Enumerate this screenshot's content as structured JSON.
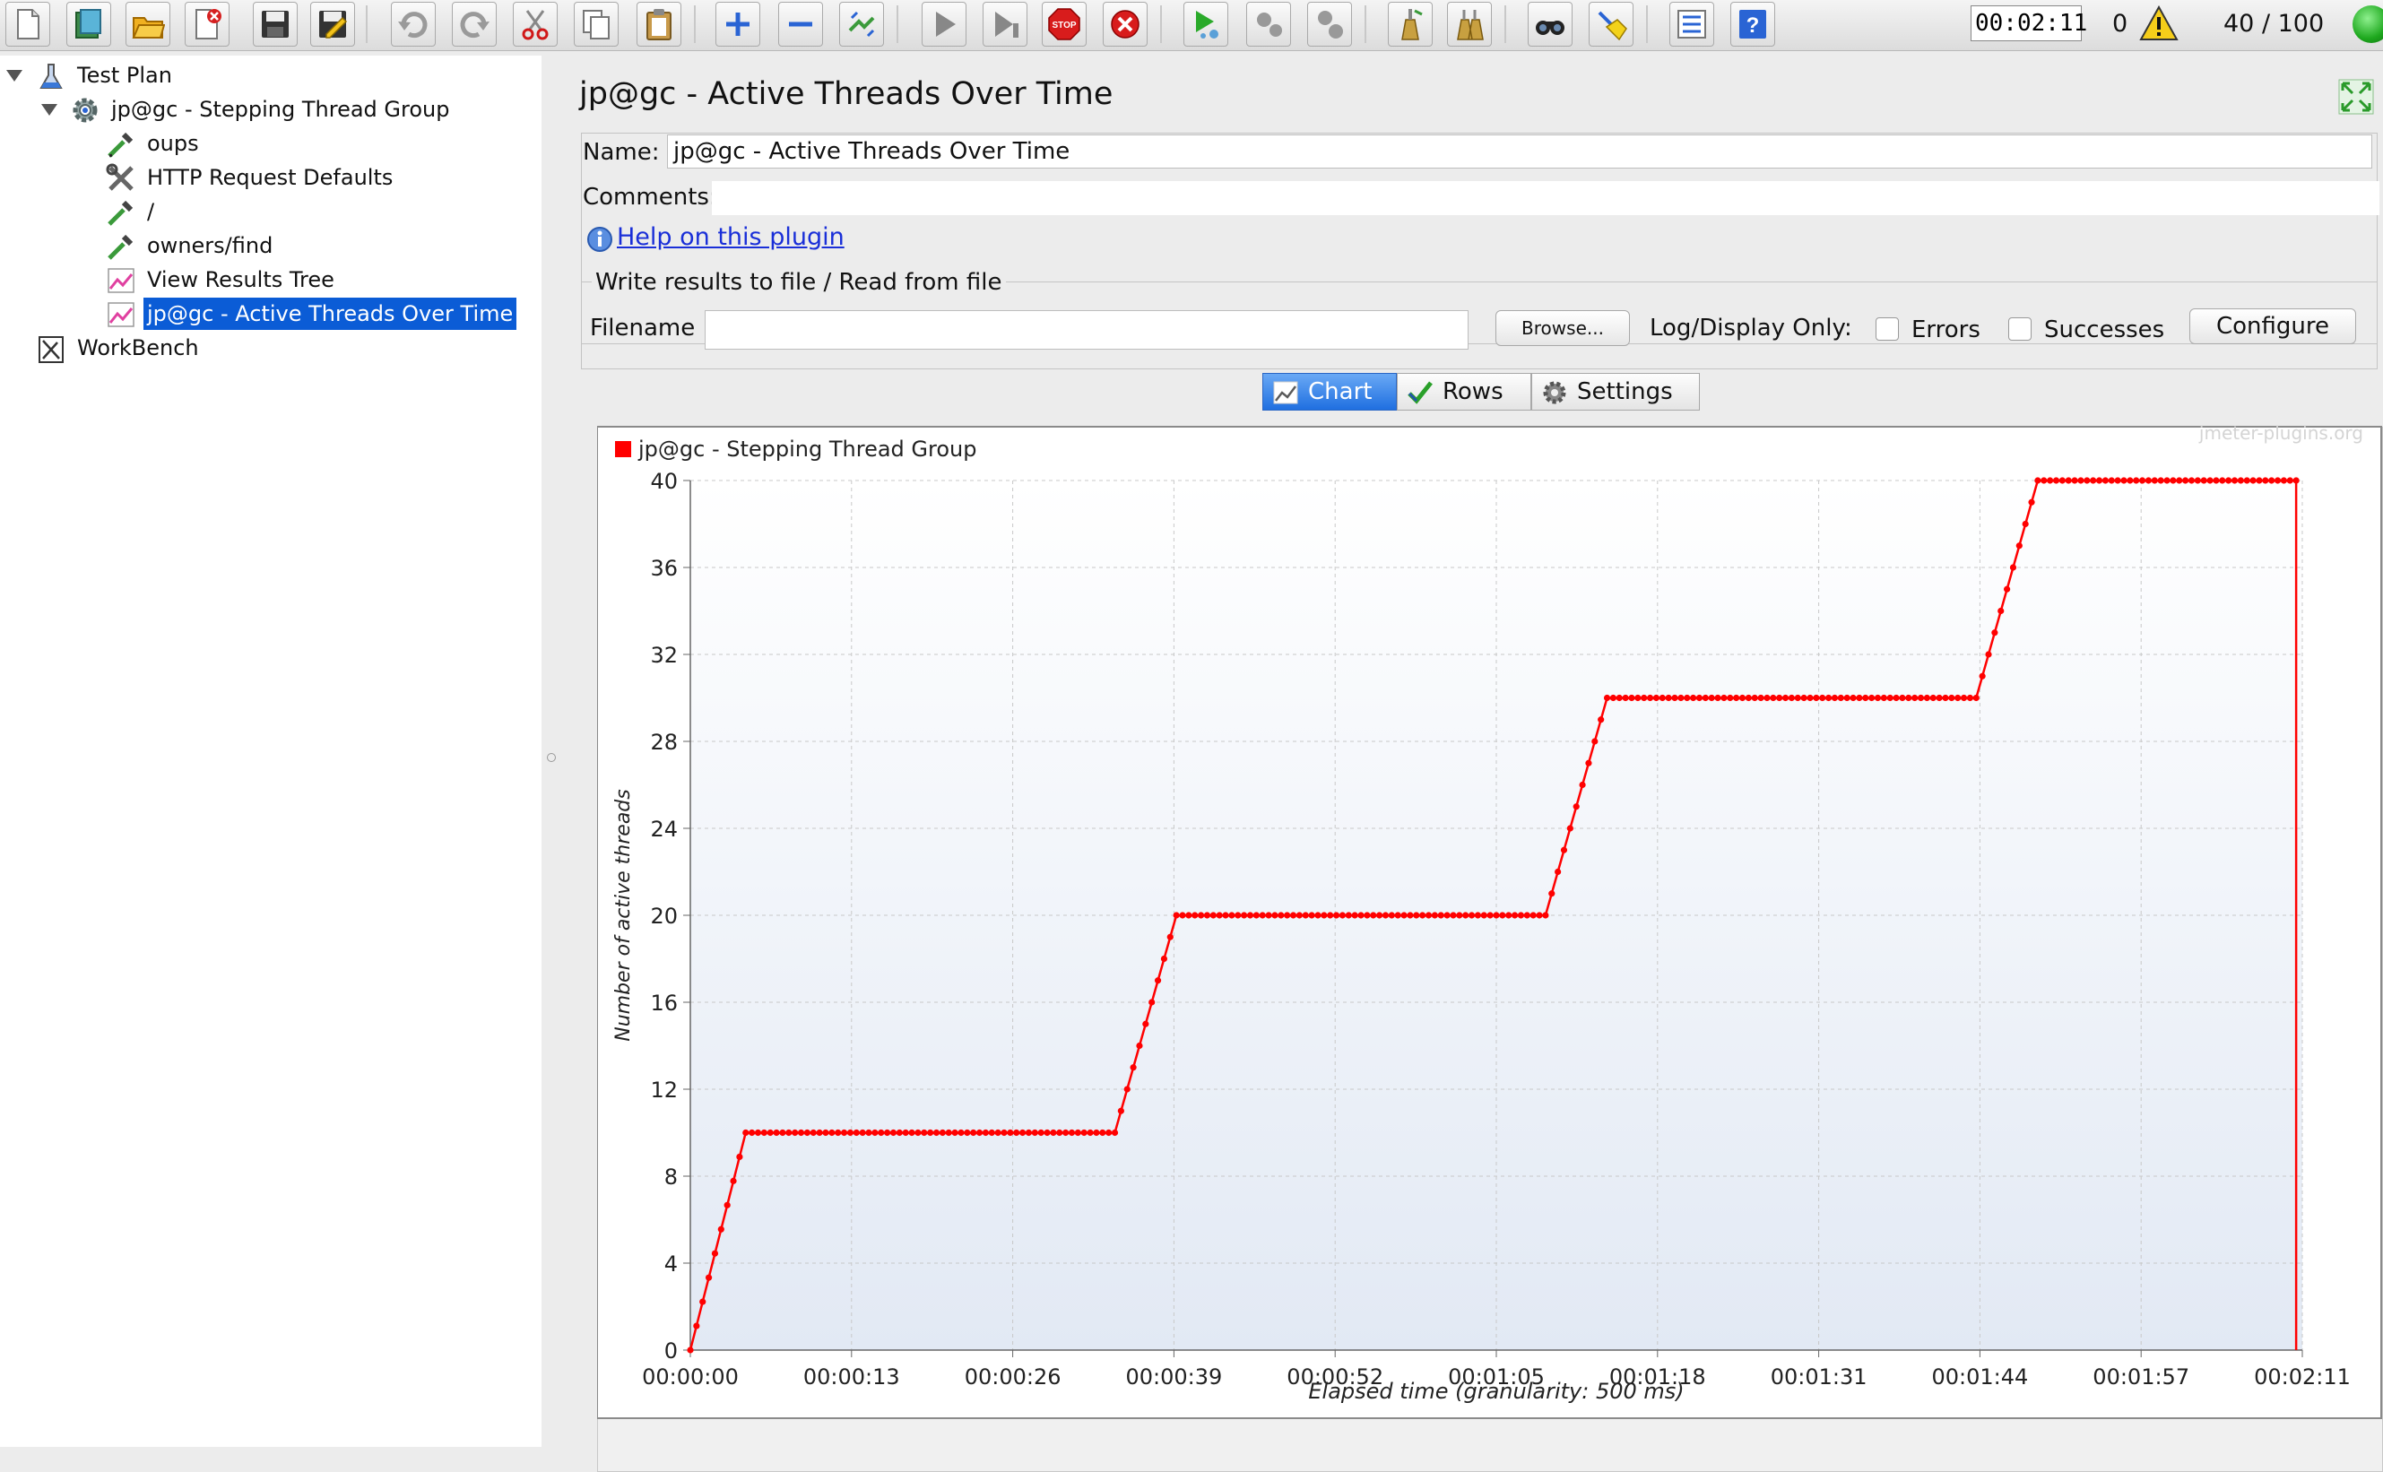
{
  "toolbar": {
    "buttons": [
      "new-icon",
      "templates-icon",
      "open-icon",
      "close-icon",
      "save-icon",
      "save-as-icon",
      "undo-icon",
      "redo-icon",
      "cut-icon",
      "copy-icon",
      "paste-icon",
      "expand-icon",
      "collapse-icon",
      "toggle-icon",
      "start-icon",
      "start-no-pause-icon",
      "stop-icon",
      "shutdown-icon",
      "remote-start-icon",
      "remote-stop-icon",
      "remote-shutdown-icon",
      "clear-icon",
      "clear-all-icon",
      "search-icon",
      "reset-search-icon",
      "function-helper-icon",
      "help-icon"
    ],
    "elapsed": "00:02:11",
    "error_count": "0",
    "threads": "40 / 100"
  },
  "tree": {
    "nodes": [
      {
        "label": "Test Plan",
        "icon": "test-plan-icon"
      },
      {
        "label": "jp@gc - Stepping Thread Group",
        "icon": "gear-icon"
      },
      {
        "label": "oups",
        "icon": "pipette-icon"
      },
      {
        "label": "HTTP Request Defaults",
        "icon": "wrench-icon"
      },
      {
        "label": "/",
        "icon": "pipette-icon"
      },
      {
        "label": "owners/find",
        "icon": "pipette-icon"
      },
      {
        "label": "View Results Tree",
        "icon": "chart-icon"
      },
      {
        "label": "jp@gc - Active Threads Over Time",
        "icon": "chart-icon"
      },
      {
        "label": "WorkBench",
        "icon": "workbench-icon"
      }
    ]
  },
  "panel": {
    "title": "jp@gc - Active Threads Over Time",
    "name_label": "Name:",
    "name_value": "jp@gc - Active Threads Over Time",
    "comments_label": "Comments:",
    "comments_value": "",
    "help_link": "Help on this plugin",
    "file_legend": "Write results to file / Read from file",
    "filename_label": "Filename",
    "filename_value": "",
    "browse_label": "Browse...",
    "log_display_label": "Log/Display Only:",
    "errors_label": "Errors",
    "successes_label": "Successes",
    "configure_label": "Configure",
    "tabs": [
      "Chart",
      "Rows",
      "Settings"
    ]
  },
  "chart_data": {
    "type": "line",
    "watermark": "jmeter-plugins.org",
    "xlabel": "Elapsed time (granularity: 500 ms)",
    "ylabel": "Number of active threads",
    "ylim": [
      0,
      40
    ],
    "yticks": [
      0,
      4,
      8,
      12,
      16,
      20,
      24,
      28,
      32,
      36,
      40
    ],
    "xlim_seconds": [
      0,
      131
    ],
    "xtick_labels": [
      "00:00:00",
      "00:00:13",
      "00:00:26",
      "00:00:39",
      "00:00:52",
      "00:01:05",
      "00:01:18",
      "00:01:31",
      "00:01:44",
      "00:01:57",
      "00:02:11"
    ],
    "legend": "top-left",
    "grid": true,
    "series": [
      {
        "name": "jp@gc - Stepping Thread Group",
        "color": "#ff0000",
        "x": [
          0,
          4.5,
          34.5,
          39.5,
          69.5,
          74.5,
          104.5,
          109.5,
          130.5,
          130.5
        ],
        "y": [
          0,
          10,
          10,
          20,
          20,
          30,
          30,
          40,
          40,
          0
        ]
      }
    ]
  }
}
